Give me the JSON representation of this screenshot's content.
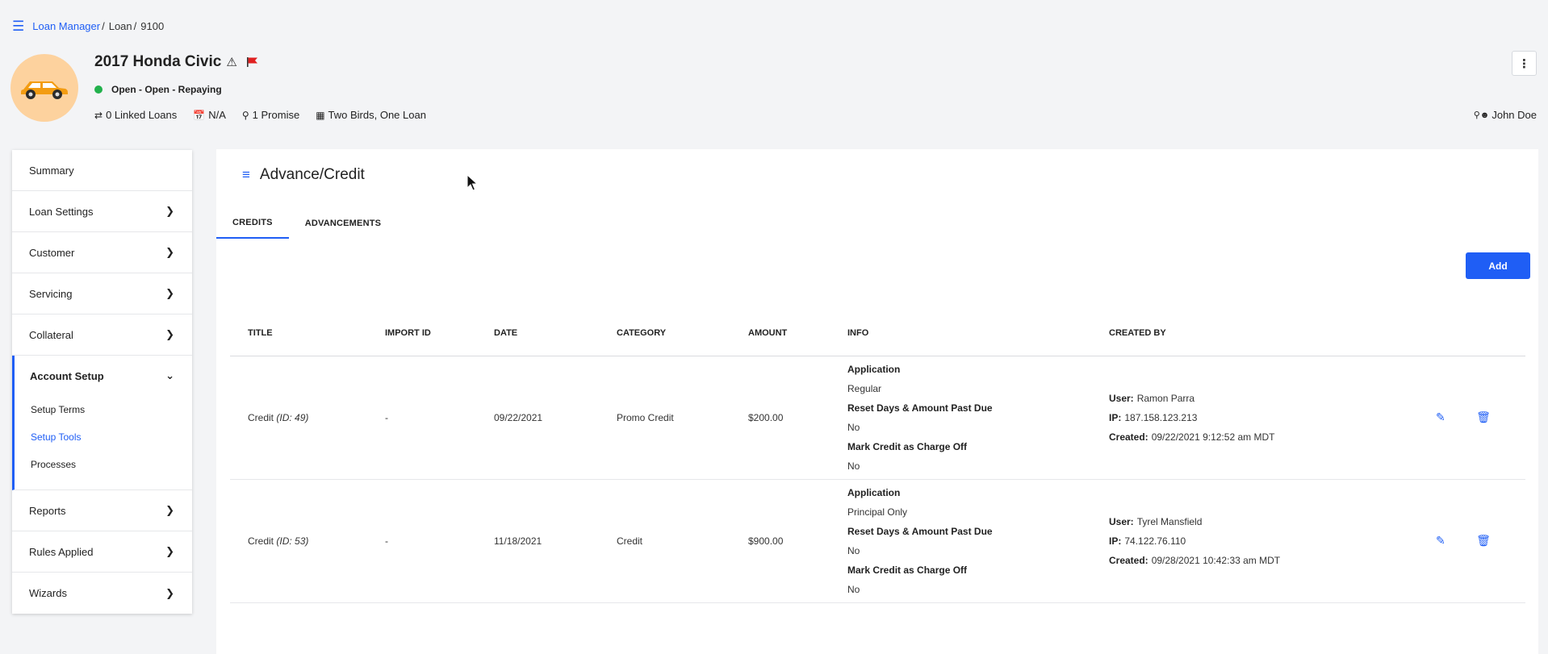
{
  "breadcrumb": {
    "root": "Loan Manager",
    "mid": "Loan",
    "id": "9100"
  },
  "header": {
    "title": "2017 Honda Civic",
    "status": "Open - Open - Repaying",
    "linked_loans": "0 Linked Loans",
    "date": "N/A",
    "promise": "1 Promise",
    "portfolio": "Two Birds, One Loan",
    "owner": "John Doe"
  },
  "sidebar": {
    "items_top": [
      {
        "label": "Summary",
        "chevron": false
      },
      {
        "label": "Loan Settings",
        "chevron": true
      },
      {
        "label": "Customer",
        "chevron": true
      },
      {
        "label": "Servicing",
        "chevron": true
      },
      {
        "label": "Collateral",
        "chevron": true
      }
    ],
    "section": {
      "label": "Account Setup",
      "subitems": [
        "Setup Terms",
        "Setup Tools",
        "Processes"
      ]
    },
    "items_bottom": [
      {
        "label": "Reports"
      },
      {
        "label": "Rules Applied"
      },
      {
        "label": "Wizards"
      }
    ]
  },
  "main": {
    "title": "Advance/Credit",
    "tabs": [
      "CREDITS",
      "ADVANCEMENTS"
    ],
    "add_label": "Add",
    "columns": [
      "TITLE",
      "IMPORT ID",
      "DATE",
      "CATEGORY",
      "AMOUNT",
      "INFO",
      "CREATED BY"
    ],
    "rows": [
      {
        "title": "Credit",
        "title_id": "(ID: 49)",
        "import_id": "-",
        "date": "09/22/2021",
        "category": "Promo Credit",
        "amount": "$200.00",
        "info": {
          "k1": "Application",
          "v1": "Regular",
          "k2": "Reset Days & Amount Past Due",
          "v2": "No",
          "k3": "Mark Credit as Charge Off",
          "v3": "No"
        },
        "created": {
          "user_label": "User:",
          "user": "Ramon Parra",
          "ip_label": "IP:",
          "ip": "187.158.123.213",
          "created_label": "Created:",
          "created": "09/22/2021 9:12:52 am MDT"
        }
      },
      {
        "title": "Credit",
        "title_id": "(ID: 53)",
        "import_id": "-",
        "date": "11/18/2021",
        "category": "Credit",
        "amount": "$900.00",
        "info": {
          "k1": "Application",
          "v1": "Principal Only",
          "k2": "Reset Days & Amount Past Due",
          "v2": "No",
          "k3": "Mark Credit as Charge Off",
          "v3": "No"
        },
        "created": {
          "user_label": "User:",
          "user": "Tyrel Mansfield",
          "ip_label": "IP:",
          "ip": "74.122.76.110",
          "created_label": "Created:",
          "created": "09/28/2021 10:42:33 am MDT"
        }
      }
    ]
  },
  "colors": {
    "accent": "#1f5ef5",
    "status_open": "#22b14c",
    "avatar_bg": "#fdd29e"
  },
  "icons": [
    "hamburger-menu-icon",
    "warning-icon",
    "flag-icon",
    "status-dot-icon",
    "swap-icon",
    "calendar-check-icon",
    "map-pin-icon",
    "building-icon",
    "key-user-icon",
    "kebab-menu-icon",
    "chevron-right-icon",
    "chevron-down-icon",
    "edit-icon",
    "trash-icon"
  ]
}
